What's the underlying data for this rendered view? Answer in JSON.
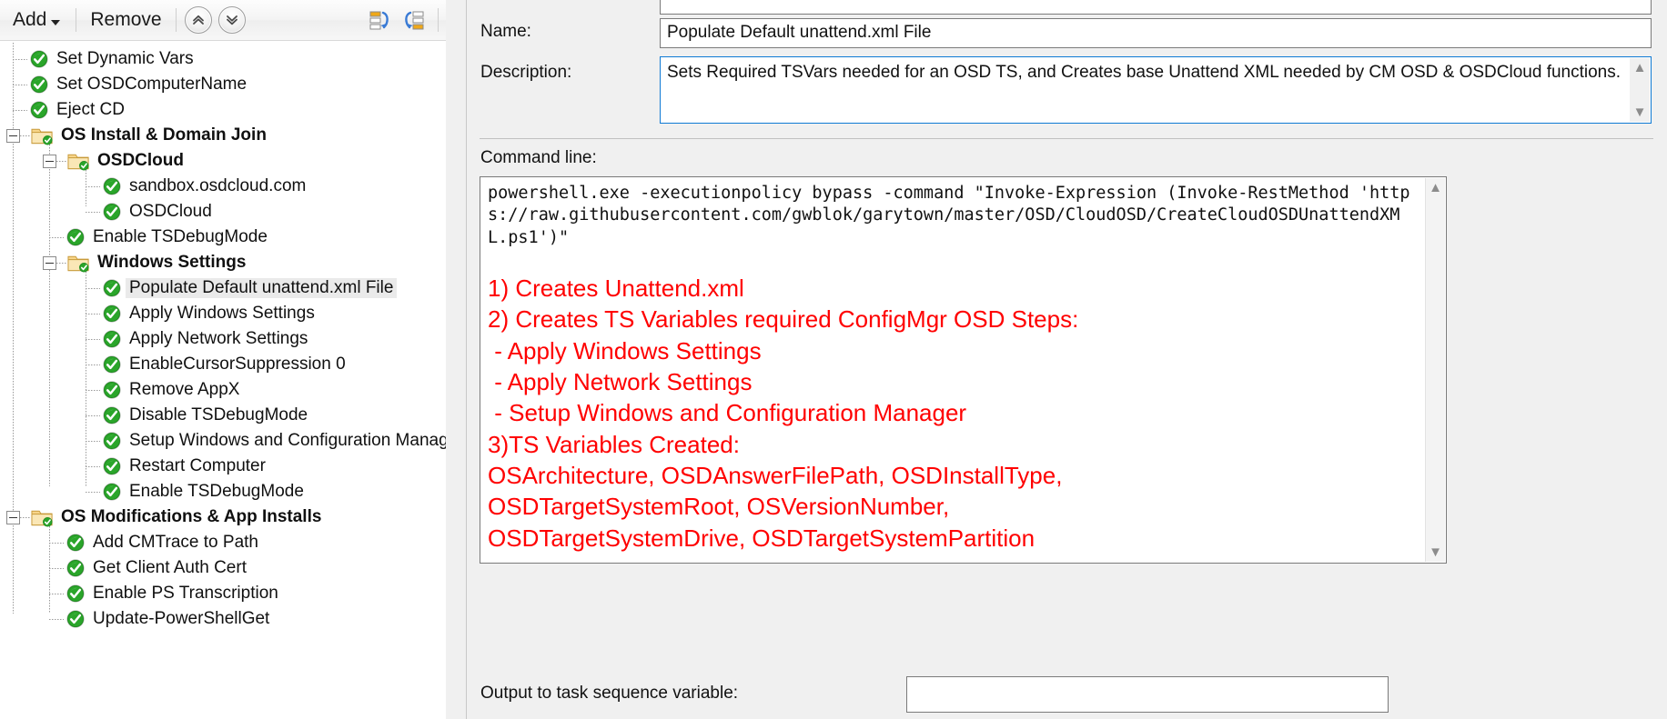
{
  "toolbar": {
    "add_label": "Add",
    "remove_label": "Remove",
    "move_up_icon": "chevrons-up-icon",
    "move_down_icon": "chevrons-down-icon",
    "collapse_all_icon": "collapse-all-icon",
    "expand_all_icon": "expand-all-icon"
  },
  "tree": {
    "selected": "Populate Default unattend.xml File",
    "items": [
      {
        "label": "Set Dynamic Vars",
        "depth": 1,
        "type": "step"
      },
      {
        "label": "Set OSDComputerName",
        "depth": 1,
        "type": "step"
      },
      {
        "label": "Eject CD",
        "depth": 1,
        "type": "step"
      },
      {
        "label": "OS Install & Domain Join",
        "depth": 1,
        "type": "group",
        "expanded": true
      },
      {
        "label": "OSDCloud",
        "depth": 2,
        "type": "group",
        "expanded": true
      },
      {
        "label": "sandbox.osdcloud.com",
        "depth": 3,
        "type": "step"
      },
      {
        "label": "OSDCloud",
        "depth": 3,
        "type": "step"
      },
      {
        "label": "Enable TSDebugMode",
        "depth": 2,
        "type": "step"
      },
      {
        "label": "Windows Settings",
        "depth": 2,
        "type": "group",
        "expanded": true
      },
      {
        "label": "Populate Default unattend.xml File",
        "depth": 3,
        "type": "step",
        "selected": true
      },
      {
        "label": "Apply Windows Settings",
        "depth": 3,
        "type": "step"
      },
      {
        "label": "Apply Network Settings",
        "depth": 3,
        "type": "step"
      },
      {
        "label": "EnableCursorSuppression 0",
        "depth": 3,
        "type": "step"
      },
      {
        "label": "Remove AppX",
        "depth": 3,
        "type": "step"
      },
      {
        "label": "Disable TSDebugMode",
        "depth": 3,
        "type": "step"
      },
      {
        "label": "Setup Windows and Configuration Manager",
        "depth": 3,
        "type": "step"
      },
      {
        "label": "Restart Computer",
        "depth": 3,
        "type": "step"
      },
      {
        "label": "Enable TSDebugMode",
        "depth": 3,
        "type": "step"
      },
      {
        "label": "OS Modifications & App Installs",
        "depth": 1,
        "type": "group",
        "expanded": true
      },
      {
        "label": "Add CMTrace to Path",
        "depth": 2,
        "type": "step"
      },
      {
        "label": "Get Client Auth Cert",
        "depth": 2,
        "type": "step"
      },
      {
        "label": "Enable PS Transcription",
        "depth": 2,
        "type": "step"
      },
      {
        "label": "Update-PowerShellGet",
        "depth": 2,
        "type": "step"
      }
    ]
  },
  "properties": {
    "name_label": "Name:",
    "name_value": "Populate Default unattend.xml File",
    "description_label": "Description:",
    "description_value": "Sets Required TSVars needed for an OSD TS, and Creates base Unattend XML needed by CM OSD & OSDCloud functions.",
    "command_line_label": "Command line:",
    "command_line_value": "powershell.exe -executionpolicy bypass -command \"Invoke-Expression (Invoke-RestMethod 'https://raw.githubusercontent.com/gwblok/garytown/master/OSD/CloudOSD/CreateCloudOSDUnattendXML.ps1')\"",
    "red_notes": "1) Creates Unattend.xml\n2) Creates TS Variables required ConfigMgr OSD Steps:\n - Apply Windows Settings\n - Apply Network Settings\n - Setup Windows and Configuration Manager\n3)TS Variables Created:\nOSArchitecture, OSDAnswerFilePath, OSDInstallType,\nOSDTargetSystemRoot, OSVersionNumber,\nOSDTargetSystemDrive, OSDTargetSystemPartition",
    "red_notes_color": "#ff0000",
    "output_var_label": "Output to task sequence variable:",
    "output_var_value": ""
  },
  "scrollbars": {
    "up_chevron": "chevron-up-icon",
    "down_chevron": "chevron-down-icon"
  }
}
